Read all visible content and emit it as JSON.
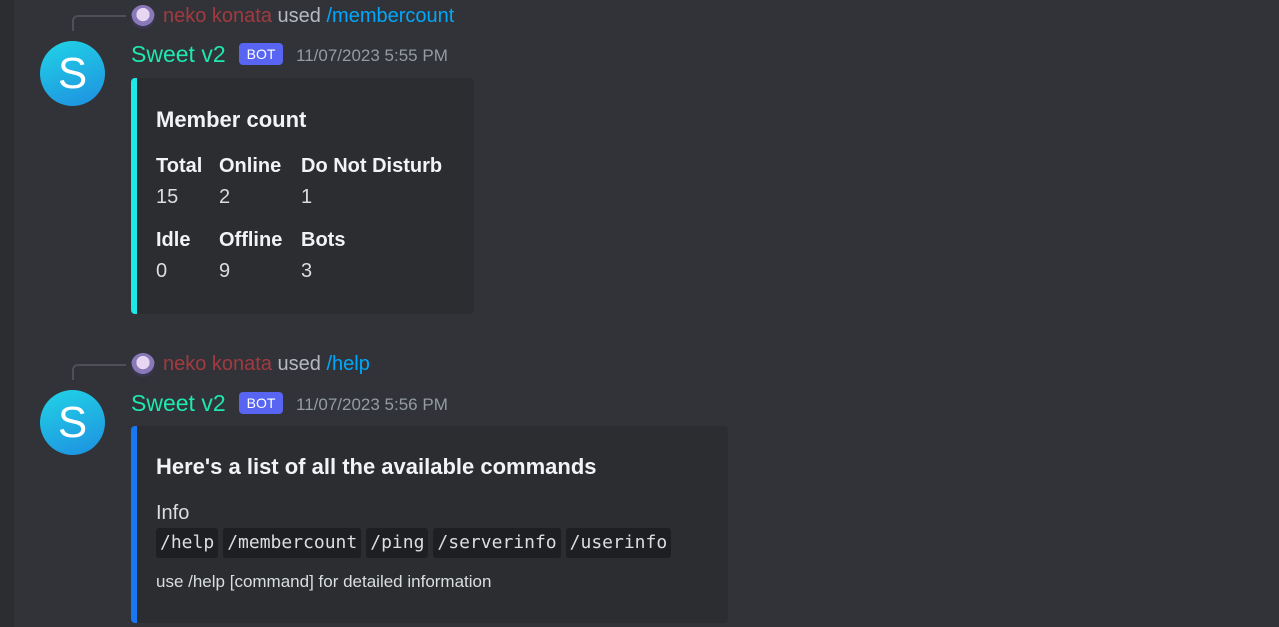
{
  "messages": [
    {
      "reply": {
        "user": "neko konata",
        "used": "used",
        "command": "/membercount"
      },
      "author": "Sweet v2",
      "avatar_letter": "S",
      "bot_tag": "BOT",
      "timestamp": "11/07/2023 5:55 PM",
      "embed": {
        "color": "#1de9e8",
        "title": "Member count",
        "fields": [
          {
            "name": "Total",
            "value": "15"
          },
          {
            "name": "Online",
            "value": "2"
          },
          {
            "name": "Do Not Disturb",
            "value": "1"
          },
          {
            "name": "Idle",
            "value": "0"
          },
          {
            "name": "Offline",
            "value": "9"
          },
          {
            "name": "Bots",
            "value": "3"
          }
        ]
      }
    },
    {
      "reply": {
        "user": "neko konata",
        "used": "used",
        "command": "/help"
      },
      "author": "Sweet v2",
      "avatar_letter": "S",
      "bot_tag": "BOT",
      "timestamp": "11/07/2023 5:56 PM",
      "embed": {
        "color": "#1877f2",
        "title": "Here's a list of all the available commands",
        "info_label": "Info",
        "commands": [
          "/help",
          "/membercount",
          "/ping",
          "/serverinfo",
          "/userinfo"
        ],
        "footer": "use /help [command] for detailed information"
      }
    }
  ],
  "icons": {
    "avatar_icon": "letter-s-avatar",
    "reply_avatar_icon": "anime-avatar"
  }
}
